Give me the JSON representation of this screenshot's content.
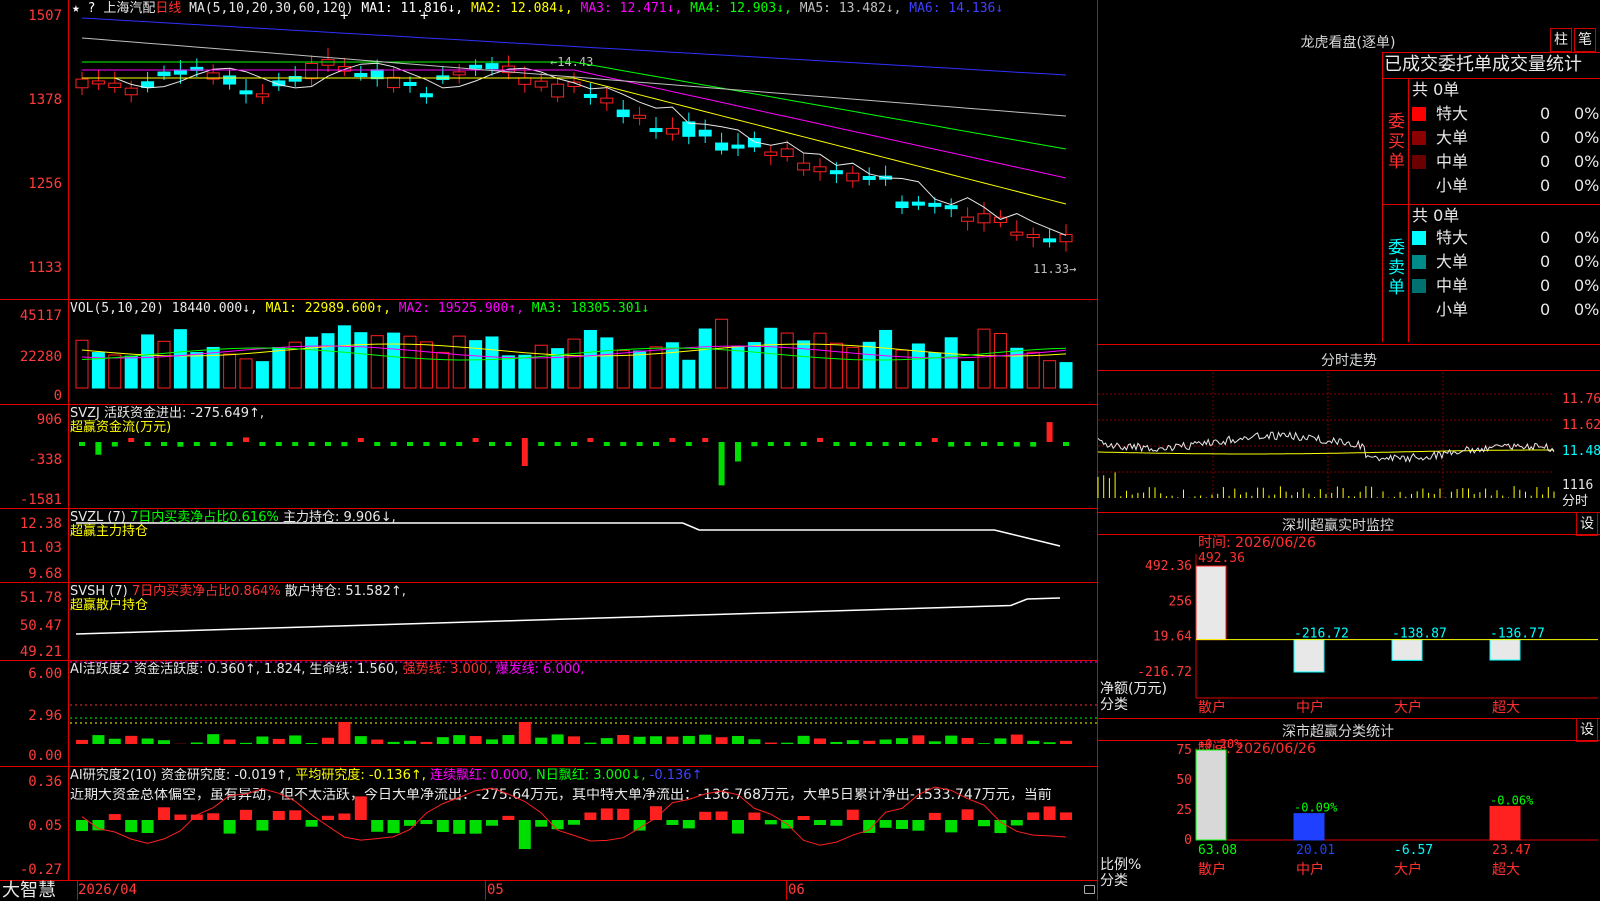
{
  "stock": {
    "name": "上海汽配",
    "period": "日线"
  },
  "header": {
    "star": "★",
    "arrow": "?",
    "ma_label": "MA(5,10,20,30,60,120)",
    "ma1": "MA1: 11.816↓,",
    "ma2": "MA2: 12.084↓,",
    "ma3": "MA3: 12.471↓,",
    "ma4": "MA4: 12.903↓,",
    "ma5": "MA5: 13.482↓,",
    "ma6": "MA6: 14.136↓"
  },
  "price_axis": [
    "1507",
    "1378",
    "1256",
    "1133"
  ],
  "price_marks": {
    "high": "14.43",
    "low": "11.33"
  },
  "vol": {
    "label": "VOL(5,10,20)",
    "value": "18440.000↓,",
    "ma1": "MA1: 22989.600↑,",
    "ma2": "MA2: 19525.900↑,",
    "ma3": "MA3: 18305.301↓",
    "axis": [
      "45117",
      "22280",
      "0"
    ]
  },
  "svzj": {
    "label": "SVZJ",
    "title": "活跃资金进出: -275.649↑,",
    "subtitle": "超赢资金流(万元)",
    "axis": [
      "906",
      "-338",
      "-1581"
    ]
  },
  "svzl": {
    "label": "SVZL (7)",
    "net": "7日内买卖净占比0.616%",
    "main": "主力持仓: 9.906↓,",
    "subtitle": "超赢主力持仓",
    "axis": [
      "12.38",
      "11.03",
      "9.68"
    ]
  },
  "svsh": {
    "label": "SVSH (7)",
    "net": "7日内买卖净占比0.864%",
    "retail": "散户持仓: 51.582↑,",
    "subtitle": "超赢散户持仓",
    "axis": [
      "51.78",
      "50.47",
      "49.21"
    ]
  },
  "ai_active": {
    "label": "AI活跃度2",
    "degree": "资金活跃度: 0.360↑,",
    "v2": "1.824,",
    "life": "生命线: 1.560,",
    "strong": "强势线: 3.000,",
    "burst": "爆发线: 6.000,",
    "axis": [
      "6.00",
      "2.96",
      "0.00"
    ]
  },
  "ai_research": {
    "label": "AI研究度2(10)",
    "degree": "资金研究度: -0.019↑,",
    "avg": "平均研究度: -0.136↑,",
    "red": "连续飘红: 0.000,",
    "nred": "N日飘红: 3.000↓,",
    "last": "-0.136↑",
    "axis": [
      "0.36",
      "0.05",
      "-0.27"
    ],
    "comment": "近期大资金总体偏空，虽有异动，但不太活跃，今日大单净流出：-275.64万元，其中特大单净流出：-136.768万元，大单5日累计净出-1533.747万元，当前"
  },
  "date_axis": {
    "d1": "2026/04",
    "d2": "05",
    "d3": "06"
  },
  "brand": "大智慧",
  "dragon": {
    "title": "龙虎看盘(逐单)",
    "btn1": "柱",
    "btn2": "笔",
    "tabs": "已成交委托单成交量统计",
    "buy": {
      "side": "委买单",
      "total": "共 0单",
      "rows": [
        {
          "name": "特大",
          "n": "0",
          "p": "0%",
          "color": "#ff0000"
        },
        {
          "name": "大单",
          "n": "0",
          "p": "0%",
          "color": "#8b0000"
        },
        {
          "name": "中单",
          "n": "0",
          "p": "0%",
          "color": "#6b0000"
        },
        {
          "name": "小单",
          "n": "0",
          "p": "0%",
          "color": ""
        }
      ]
    },
    "sell": {
      "side": "委卖单",
      "total": "共 0单",
      "rows": [
        {
          "name": "特大",
          "n": "0",
          "p": "0%",
          "color": "#00ffff"
        },
        {
          "name": "大单",
          "n": "0",
          "p": "0%",
          "color": "#008b8b"
        },
        {
          "name": "中单",
          "n": "0",
          "p": "0%",
          "color": "#007070"
        },
        {
          "name": "小单",
          "n": "0",
          "p": "0%",
          "color": ""
        }
      ]
    }
  },
  "intraday": {
    "title": "分时走势",
    "axis": [
      "11.76",
      "11.62",
      "11.48",
      "1116"
    ],
    "footer": "分时"
  },
  "sz_monitor": {
    "title": "深圳超赢实时监控",
    "btn": "设",
    "date": "时间: 2026/06/26",
    "axis": [
      "492.36",
      "256",
      "19.64",
      "-216.72"
    ],
    "ylabel": "净额(万元)",
    "xlabel": "分类",
    "cats": [
      "散户",
      "中户",
      "大户",
      "超大"
    ],
    "values": [
      "492.36",
      "-216.72",
      "-138.87",
      "-136.77"
    ]
  },
  "sz_class": {
    "title": "深市超赢分类统计",
    "btn": "设",
    "date": "时间: 2026/06/26",
    "axis": [
      "75",
      "50",
      "25",
      "0"
    ],
    "ylabel": "比例%",
    "xlabel": "分类",
    "cats": [
      "散户",
      "中户",
      "大户",
      "超大"
    ],
    "top": [
      "+0.20%",
      "-0.09%",
      "",
      "-0.06%"
    ],
    "bottom": [
      "63.08",
      "20.01",
      "-6.57",
      "23.47"
    ]
  }
}
